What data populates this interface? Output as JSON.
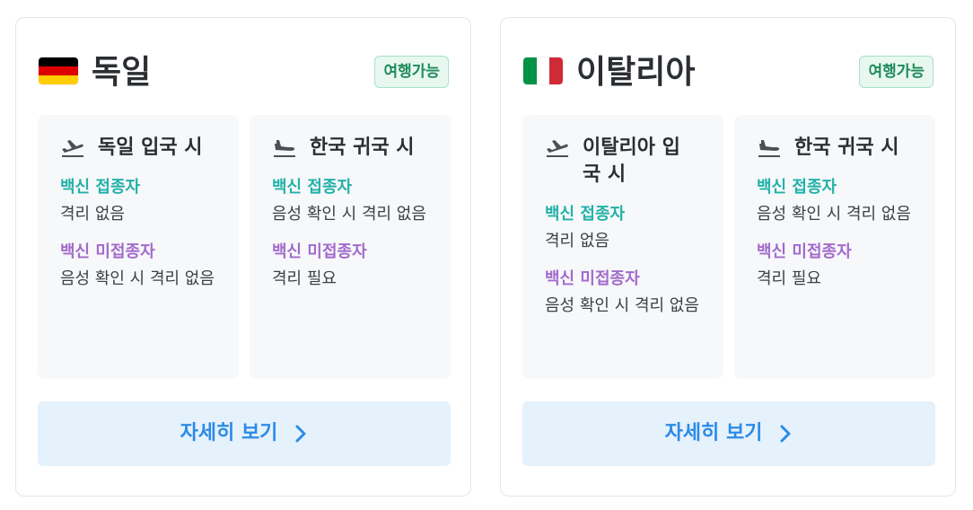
{
  "cards": [
    {
      "flag": {
        "icon": "germany-flag-icon",
        "colors": [
          "#000000",
          "#dd0000",
          "#ffce00"
        ]
      },
      "country": "독일",
      "badge": "여행가능",
      "entry": {
        "icon": "departure-plane-icon",
        "title": "독일 입국 시",
        "vaccinated_label": "백신 접종자",
        "vaccinated_value": "격리 없음",
        "unvaccinated_label": "백신 미접종자",
        "unvaccinated_value": "음성 확인 시 격리 없음"
      },
      "return": {
        "icon": "arrival-plane-icon",
        "title": "한국 귀국 시",
        "vaccinated_label": "백신 접종자",
        "vaccinated_value": "음성 확인 시 격리 없음",
        "unvaccinated_label": "백신 미접종자",
        "unvaccinated_value": "격리 필요"
      },
      "detail_button": "자세히 보기"
    },
    {
      "flag": {
        "icon": "italy-flag-icon",
        "colors": [
          "#009246",
          "#ffffff",
          "#ce2b37"
        ]
      },
      "country": "이탈리아",
      "badge": "여행가능",
      "entry": {
        "icon": "departure-plane-icon",
        "title": "이탈리아 입국 시",
        "vaccinated_label": "백신 접종자",
        "vaccinated_value": "격리 없음",
        "unvaccinated_label": "백신 미접종자",
        "unvaccinated_value": "음성 확인 시 격리 없음"
      },
      "return": {
        "icon": "arrival-plane-icon",
        "title": "한국 귀국 시",
        "vaccinated_label": "백신 접종자",
        "vaccinated_value": "음성 확인 시 격리 없음",
        "unvaccinated_label": "백신 미접종자",
        "unvaccinated_value": "격리 필요"
      },
      "detail_button": "자세히 보기"
    }
  ],
  "colors": {
    "vaccinated": "#22b1a8",
    "unvaccinated": "#a36acb",
    "badge_text": "#1f8a5a",
    "badge_bg": "#e8f8f1",
    "button_text": "#2b8be6",
    "button_bg": "#e5f1fb"
  }
}
